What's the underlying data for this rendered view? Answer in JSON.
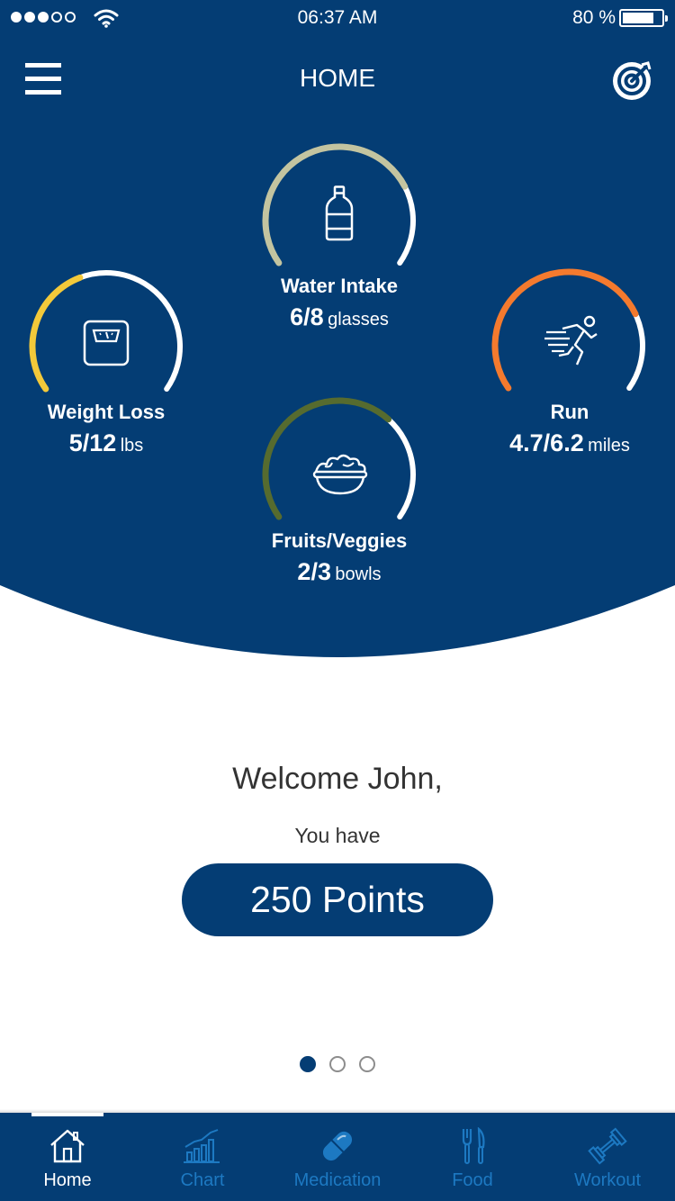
{
  "status_bar": {
    "time": "06:37 AM",
    "battery_percent": "80 %",
    "battery_level": 0.8,
    "signal_bars_filled": 3,
    "signal_bars_total": 5
  },
  "header": {
    "title": "HOME",
    "menu_icon": "hamburger-menu-icon",
    "goal_icon": "target-icon"
  },
  "trackers": {
    "water": {
      "label": "Water Intake",
      "value": "6/8",
      "unit": "glasses",
      "progress": 0.75,
      "color": "#c3c4a0",
      "icon": "water-bottle-icon"
    },
    "weight": {
      "label": "Weight Loss",
      "value": "5/12",
      "unit": "lbs",
      "progress": 0.4167,
      "color": "#f3c93a",
      "icon": "scale-icon"
    },
    "run": {
      "label": "Run",
      "value": "4.7/6.2",
      "unit": "miles",
      "progress": 0.758,
      "color": "#f47a2e",
      "icon": "runner-icon"
    },
    "fruits": {
      "label": "Fruits/Veggies",
      "value": "2/3",
      "unit": "bowls",
      "progress": 0.6667,
      "color": "#566b2f",
      "icon": "salad-bowl-icon"
    }
  },
  "welcome": {
    "greeting": "Welcome John,",
    "subtitle": "You have",
    "points": "250 Points"
  },
  "pager": {
    "total": 3,
    "active": 1
  },
  "tabs": [
    {
      "label": "Home",
      "icon": "home-icon",
      "active": true
    },
    {
      "label": "Chart",
      "icon": "bar-chart-icon",
      "active": false
    },
    {
      "label": "Medication",
      "icon": "pill-icon",
      "active": false
    },
    {
      "label": "Food",
      "icon": "fork-knife-icon",
      "active": false
    },
    {
      "label": "Workout",
      "icon": "dumbbell-icon",
      "active": false
    }
  ],
  "colors": {
    "primary": "#043d74",
    "tab_inactive": "#1d79c2",
    "track": "#ffffff"
  }
}
